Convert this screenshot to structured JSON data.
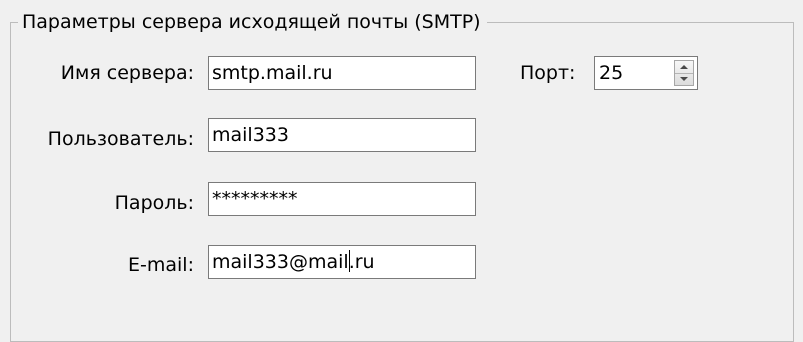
{
  "group": {
    "title": "Параметры сервера исходящей почты (SMTP)"
  },
  "server": {
    "label": "Имя сервера:",
    "value": "smtp.mail.ru"
  },
  "port": {
    "label": "Порт:",
    "value": "25"
  },
  "user": {
    "label": "Пользователь:",
    "value": "mail333"
  },
  "password": {
    "label": "Пароль:",
    "value": "*********"
  },
  "email": {
    "label": "E-mail:",
    "value_before_caret": "mail333@mail",
    "value_after_caret": ".ru"
  },
  "icons": {
    "spin_up": "triangle-up-icon",
    "spin_down": "triangle-down-icon"
  },
  "colors": {
    "background": "#f0f0f0",
    "field_border": "#7a7a7a",
    "group_border": "#bcbcbc"
  }
}
